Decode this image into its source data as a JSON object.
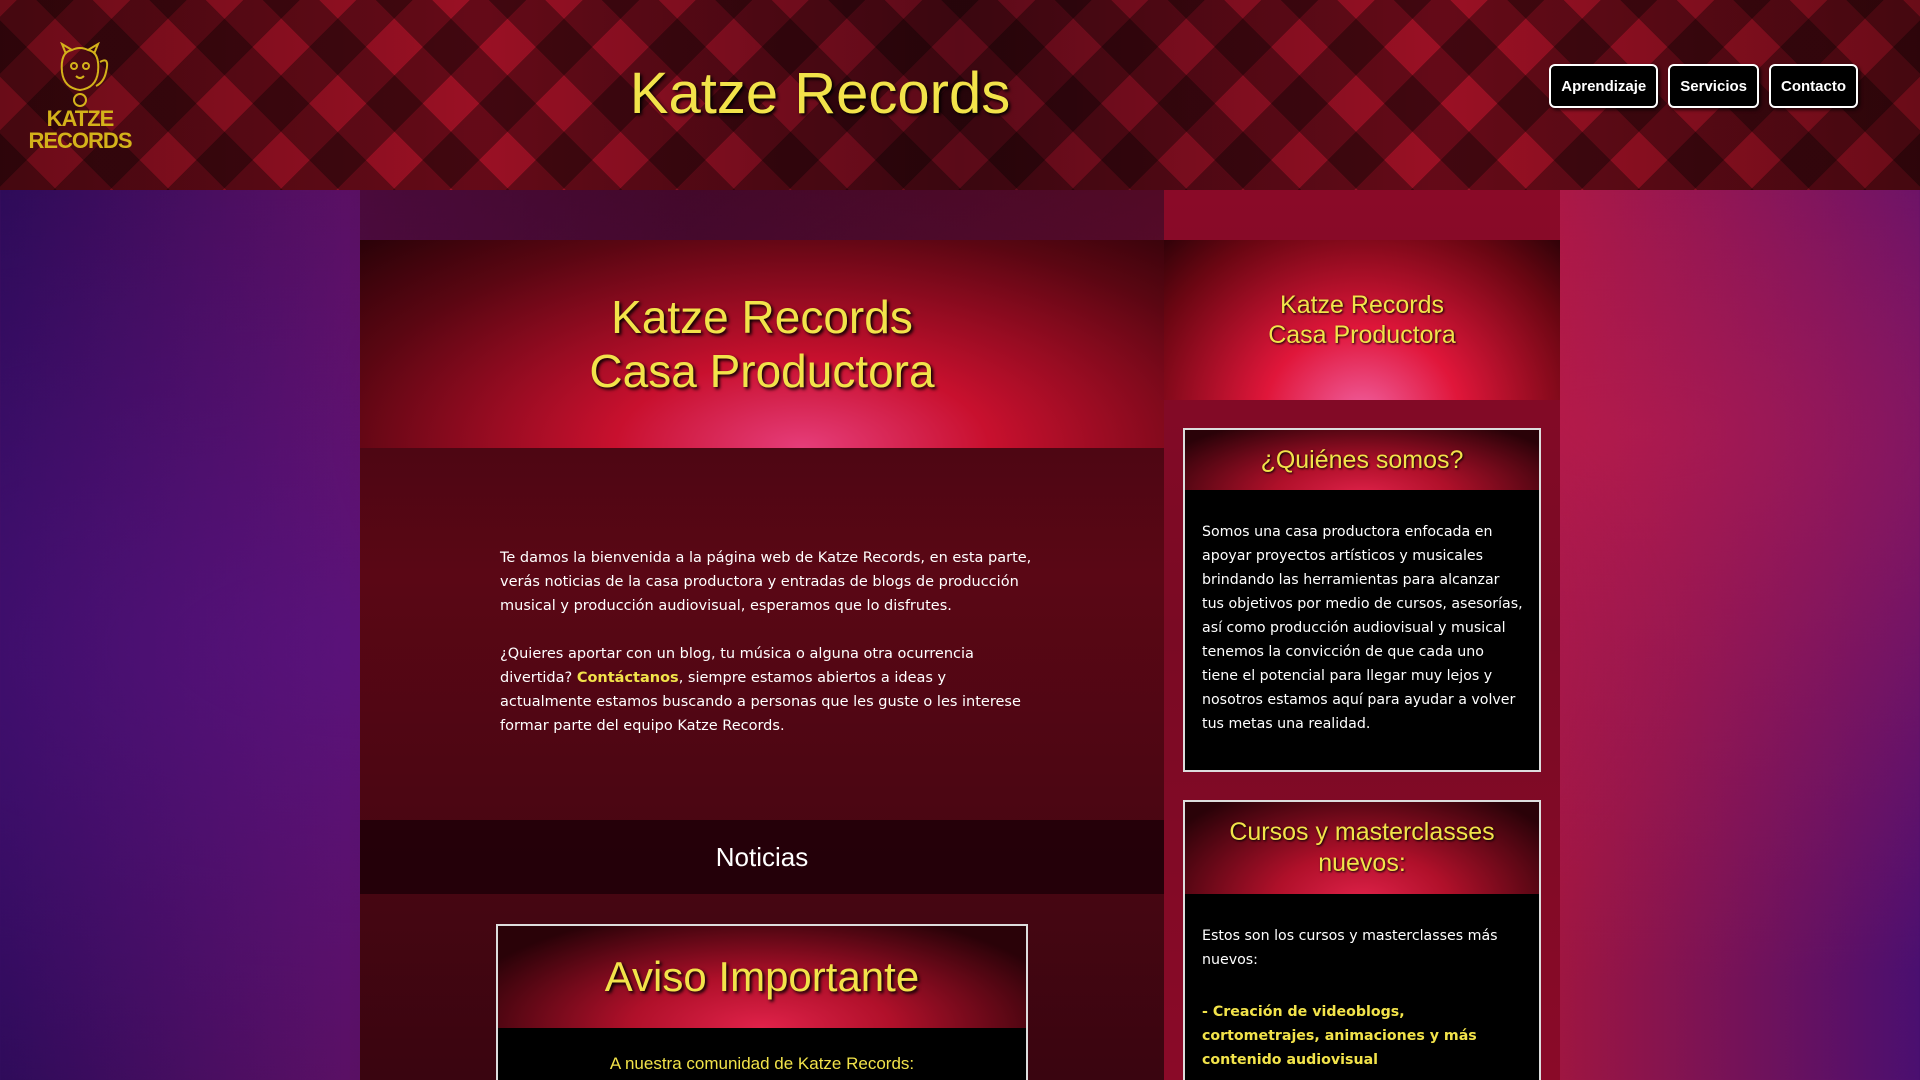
{
  "header": {
    "logo_text_1": "KATZE",
    "logo_text_2": "RECORDS",
    "site_title": "Katze Records",
    "nav": [
      "Aprendizaje",
      "Servicios",
      "Contacto"
    ]
  },
  "main": {
    "hero_line_1": "Katze Records",
    "hero_line_2": "Casa Productora",
    "intro_p1": "Te damos la bienvenida a la página web de Katze Records, en esta parte, verás noticias de la casa productora y entradas de blogs de producción musical y producción audiovisual, esperamos que lo disfrutes.",
    "intro_p2_a": "¿Quieres aportar con un blog, tu música o alguna otra ocurrencia divertida? ",
    "intro_p2_link": "Contáctanos",
    "intro_p2_b": ", siempre estamos abiertos a ideas y actualmente estamos buscando a personas que les guste o les interese formar parte del equipo Katze Records.",
    "news_title": "Noticias",
    "notice_title": "Aviso Importante",
    "notice_sub": "A nuestra comunidad de Katze Records:"
  },
  "sidebar": {
    "hero_line_1": "Katze Records",
    "hero_line_2": "Casa Productora",
    "about_title": "¿Quiénes somos?",
    "about_text": "Somos una casa productora enfocada en apoyar proyectos artísticos y musicales brindando las herramientas para alcanzar tus objetivos por medio de cursos, asesorías, así como producción audiovisual y musical tenemos la convicción de que cada uno tiene el potencial para llegar muy lejos y nosotros estamos aquí para ayudar a volver tus metas una realidad.",
    "courses_title_1": "Cursos y masterclasses",
    "courses_title_2": "nuevos:",
    "courses_intro": "Estos son los cursos y masterclasses más nuevos:",
    "course_1": "- Creación de videoblogs, cortometrajes, animaciones y más contenido audiovisual"
  },
  "colors": {
    "accent_yellow": "#f2e34a",
    "brand_red": "#c8102e"
  }
}
